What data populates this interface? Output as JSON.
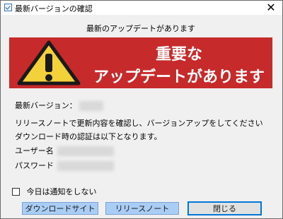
{
  "window": {
    "title": "最新バージョンの確認",
    "close_glyph": "✕"
  },
  "panel": {
    "heading": "最新のアップデートがあります",
    "banner": {
      "line1": "重要な",
      "line2": "アップデートがあります",
      "color": "#c62a2a",
      "icon": "warning-icon"
    }
  },
  "info": {
    "latest_version_label": "最新バージョン：",
    "release_note_text": "リリースノートで更新内容を確認し、バージョンアップをしてください",
    "auth_text": "ダウンロード時の認証は以下となります。",
    "username_label": "ユーザー名",
    "password_label": "パスワード"
  },
  "options": {
    "dont_notify_today": "今日は通知をしない",
    "checked": false
  },
  "buttons": {
    "download_site": "ダウンロードサイト",
    "release_notes": "リリースノート",
    "close": "閉じる"
  }
}
